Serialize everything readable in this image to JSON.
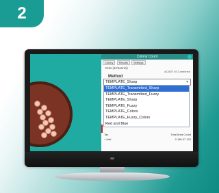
{
  "step": {
    "number": "2"
  },
  "app": {
    "window_title": "Colony Count",
    "tabs": [
      "Colony",
      "Results",
      "Settings"
    ],
    "channel_label": "Dots (1Channel)",
    "right_note": "ACATE 45 Combined",
    "method": {
      "label": "Method",
      "selected_value": "TEMPLATE_Sharp",
      "options": [
        "TEMPLATE_Transmitted_Sharp",
        "TEMPLATE_Transmitted_Fuzzy",
        "TEMPLATE_Sharp",
        "TEMPLATE_Fuzzy",
        "TEMPLATE_Colors",
        "TEMPLATE_Fuzzy_Colors",
        "Red and Blue"
      ],
      "highlighted_index": 0
    },
    "footer": {
      "left1": "Tas",
      "left2": "+ Add",
      "cols1": "Total  Area  Count",
      "cols2": "0   156.37   123"
    }
  }
}
